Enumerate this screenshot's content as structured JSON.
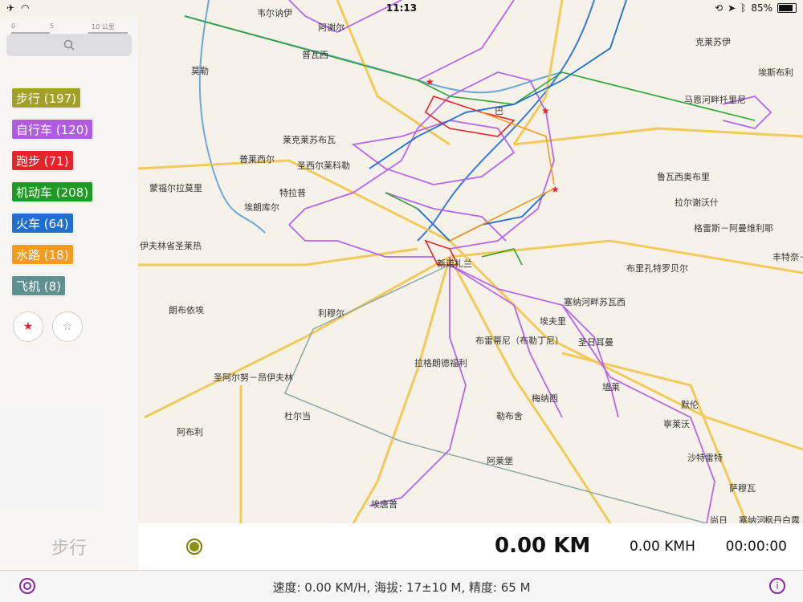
{
  "status_bar": {
    "time": "11:13",
    "battery": "85%",
    "left_icons": [
      "airplane-icon",
      "wifi-icon"
    ],
    "right_icons": [
      "rotation-lock-icon",
      "location-icon",
      "bluetooth-icon",
      "battery-icon"
    ]
  },
  "sidebar": {
    "scale_ticks": [
      "0",
      "5",
      "10 公里"
    ],
    "search_icon": "search-icon",
    "categories": [
      {
        "label": "步行 (197)",
        "color": "#a3a025"
      },
      {
        "label": "自行车 (120)",
        "color": "#b15be5"
      },
      {
        "label": "跑步 (71)",
        "color": "#e8242a"
      },
      {
        "label": "机动车 (208)",
        "color": "#1f9a22"
      },
      {
        "label": "火车 (64)",
        "color": "#1f6fd1"
      },
      {
        "label": "水路 (18)",
        "color": "#f59b20"
      },
      {
        "label": "飞机 (8)",
        "color": "#5f9190"
      }
    ],
    "star_filled_icon": "star-filled-icon",
    "star_outline_icon": "star-outline-icon",
    "ghost_label": "步行"
  },
  "places": [
    {
      "name": "韦尔讷伊"
    },
    {
      "name": "阿谢尔"
    },
    {
      "name": "普瓦西"
    },
    {
      "name": "莫勒"
    },
    {
      "name": "莱克莱苏布瓦"
    },
    {
      "name": "普莱西尔"
    },
    {
      "name": "圣西尔莱科勒"
    },
    {
      "name": "蒙福尔拉莫里"
    },
    {
      "name": "特拉普"
    },
    {
      "name": "埃朗库尔"
    },
    {
      "name": "伊夫林省圣莱热"
    },
    {
      "name": "朗布依埃"
    },
    {
      "name": "利穆尔"
    },
    {
      "name": "圣阿尔努－昂伊夫林"
    },
    {
      "name": "阿布利"
    },
    {
      "name": "杜尔当"
    },
    {
      "name": "克莱苏伊"
    },
    {
      "name": "埃斯布利"
    },
    {
      "name": "马恩河畔托里尼"
    },
    {
      "name": "鲁瓦西奥布里"
    },
    {
      "name": "拉尔谢沃什"
    },
    {
      "name": "格雷斯－阿曼维利耶"
    },
    {
      "name": "丰特奈－"
    },
    {
      "name": "布里孔特罗贝尔"
    },
    {
      "name": "塞纳河畔苏瓦西"
    },
    {
      "name": "埃夫里"
    },
    {
      "name": "布雷蒂尼（布勒丁尼）"
    },
    {
      "name": "圣日耳曼"
    },
    {
      "name": "拉格朗德福利"
    },
    {
      "name": "埴莱"
    },
    {
      "name": "默伦"
    },
    {
      "name": "梅纳西"
    },
    {
      "name": "勒布舍"
    },
    {
      "name": "寧莱沃"
    },
    {
      "name": "沙特雷特"
    },
    {
      "name": "阿莱堡"
    },
    {
      "name": "萨穆瓦"
    },
    {
      "name": "埃唐普"
    },
    {
      "name": "尚日"
    },
    {
      "name": "塞纳河"
    },
    {
      "name": "枫丹白露"
    },
    {
      "name": "新诺扎兰"
    },
    {
      "name": "巴"
    }
  ],
  "bottom_bar": {
    "distance": "0.00 KM",
    "speed": "0.00 KMH",
    "elapsed": "00:00:00"
  },
  "info_bar": {
    "text": "速度: 0.00 KM/H, 海拔: 17±10 M, 精度: 65 M",
    "left_icon": "record-icon",
    "right_icon": "info-icon"
  }
}
